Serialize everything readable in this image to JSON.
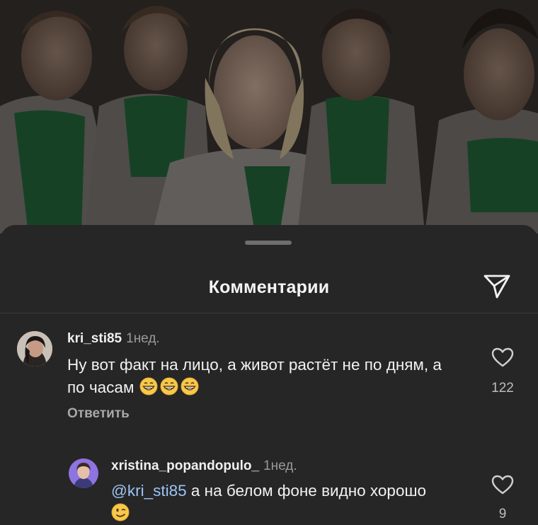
{
  "sheet": {
    "title": "Комментарии"
  },
  "icons": {
    "share": "paper-plane-icon",
    "like": "heart-outline-icon",
    "handle": "drag-handle"
  },
  "comments": [
    {
      "username": "kri_sti85",
      "time": "1нед.",
      "text": "Ну вот факт на лицо, а живот растёт не по дням, а по часам",
      "emoji": [
        "grinning-face-emoji",
        "grinning-face-emoji",
        "grinning-face-emoji"
      ],
      "reply_label": "Ответить",
      "likes": "122"
    },
    {
      "username": "xristina_popandopulo_",
      "time": "1нед.",
      "mention": "@kri_sti85",
      "text": "а на белом фоне видно хорошо",
      "emoji": [
        "winking-face-emoji"
      ],
      "likes": "9"
    }
  ],
  "colors": {
    "sheet_bg": "#262626",
    "mention": "#9cc4f5",
    "meta_gray": "#9a9a9a"
  }
}
